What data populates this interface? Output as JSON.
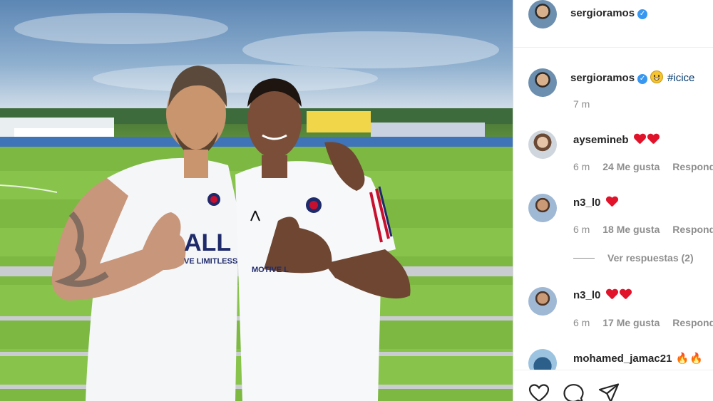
{
  "post": {
    "author": "sergioramos",
    "verified": true,
    "caption_hashtag": "#icice",
    "caption_age": "7 m"
  },
  "photo": {
    "jersey_text": "ALL",
    "jersey_tagline": "VE LIMITLESS",
    "jersey_tagline_right": "MOTIVE L"
  },
  "comments": [
    {
      "user": "aysemineb",
      "hearts": 2,
      "age": "6 m",
      "likes": "24 Me gusta",
      "reply": "Responder"
    },
    {
      "user": "n3_l0",
      "hearts": 1,
      "age": "6 m",
      "likes": "18 Me gusta",
      "reply": "Responder",
      "view_replies": "Ver respuestas (2)"
    },
    {
      "user": "n3_l0",
      "hearts": 2,
      "age": "6 m",
      "likes": "17 Me gusta",
      "reply": "Responder"
    },
    {
      "user": "mohamed_jamac21",
      "emoji": "fire",
      "emoji_count": 2
    }
  ],
  "actions": [
    {
      "icon": "heart-outline-icon"
    },
    {
      "icon": "comment-bubble-icon"
    },
    {
      "icon": "share-paper-plane-icon"
    }
  ],
  "colors": {
    "verified_blue": "#3897f0",
    "hashtag": "#00376b",
    "heart_red": "#e0132b",
    "meta_gray": "#8e8e8e"
  }
}
